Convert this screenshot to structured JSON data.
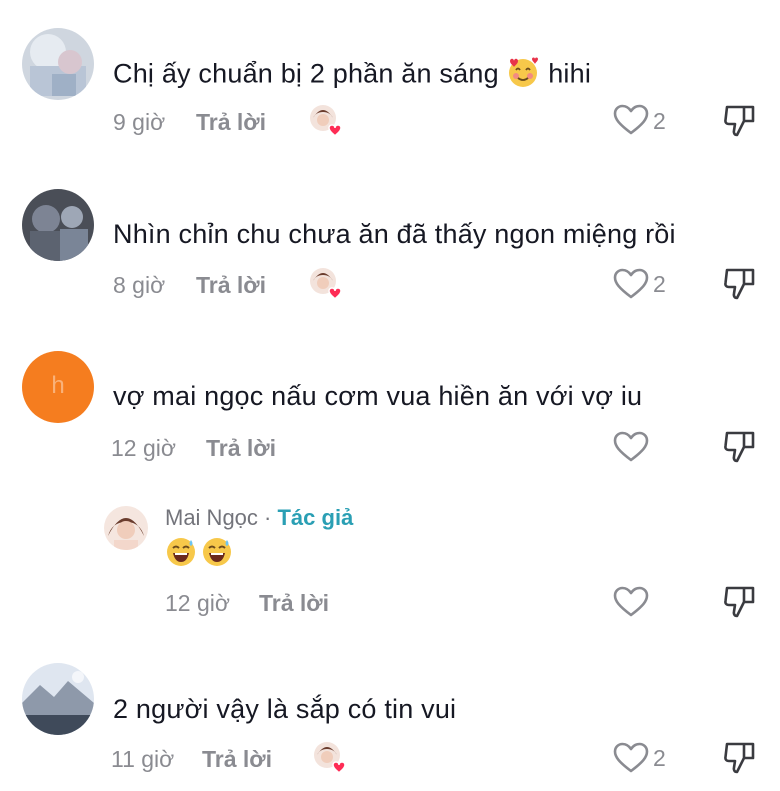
{
  "comments": [
    {
      "text": "Chị ấy chuẩn bị 2 phần ăn sáng",
      "text_suffix": "hihi",
      "time": "9 giờ",
      "reply": "Trả lời",
      "likes": "2"
    },
    {
      "text": "Nhìn chỉn chu chưa ăn đã thấy ngon miệng rồi",
      "time": "8 giờ",
      "reply": "Trả lời",
      "likes": "2"
    },
    {
      "text": "vợ mai ngọc nấu cơm vua hiền ăn với vợ iu",
      "avatar_letter": "h",
      "time": "12 giờ",
      "reply": "Trả lời"
    },
    {
      "text": "2 người vậy là sắp có tin vui",
      "time": "11 giờ",
      "reply": "Trả lời",
      "likes": "2"
    }
  ],
  "author_reply": {
    "name": "Mai Ngọc",
    "separator": " · ",
    "tag": "Tác giả",
    "time": "12 giờ",
    "reply": "Trả lời"
  },
  "colors": {
    "meta": "#8a8b91",
    "author_tag": "#2a9fb4",
    "orange_avatar": "#f57d1f",
    "liked_heart": "#fe2c55"
  },
  "icons": [
    "heart-outline-icon",
    "dislike-icon",
    "creator-liked-icon",
    "smiling-hearts-emoji",
    "laughing-sweat-emoji"
  ]
}
